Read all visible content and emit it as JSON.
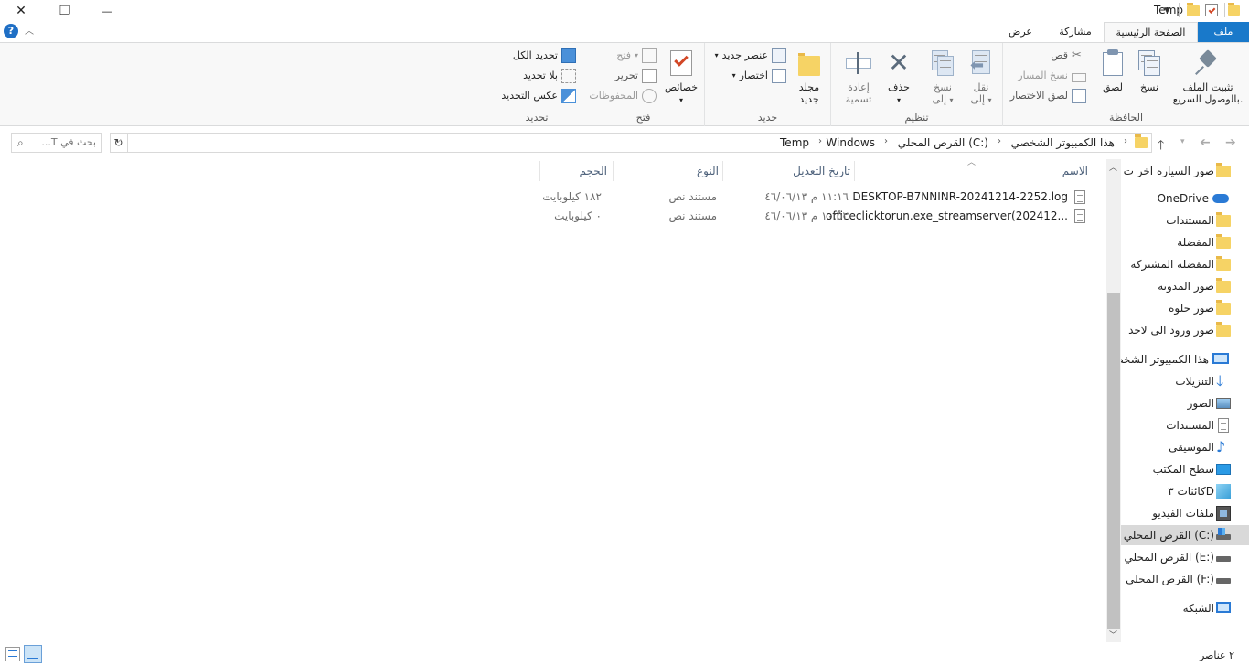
{
  "window": {
    "title": "Temp",
    "close_glyph": "✕",
    "restore_glyph": "❐",
    "minimize_glyph": "—"
  },
  "ribbon_tabs": [
    {
      "label": "ملف"
    },
    {
      "label": "الصفحة الرئيسية"
    },
    {
      "label": "مشاركة"
    },
    {
      "label": "عرض"
    }
  ],
  "help_glyph": "?",
  "clipboard": {
    "group_label": "الحافظة",
    "pin": "تثبيت الملف بالوصول السريع.",
    "copy": "نسخ",
    "paste": "لصق",
    "cut": "قص",
    "copy_path": "نسخ المسار",
    "paste_shortcut": "لصق الاختصار"
  },
  "organize": {
    "group_label": "تنظيم",
    "move_to": "نقل إلى",
    "copy_to": "نسخ إلى",
    "delete": "حذف",
    "rename": "إعادة تسمية"
  },
  "new": {
    "group_label": "جديد",
    "new_folder": "مجلد جديد",
    "new_item": "عنصر جديد",
    "shortcut": "اختصار"
  },
  "open": {
    "group_label": "فتح",
    "properties": "خصائص",
    "open": "فتح",
    "edit": "تحرير",
    "history": "المحفوظات"
  },
  "select": {
    "group_label": "تحديد",
    "select_all": "تحديد الكل",
    "select_none": "بلا تحديد",
    "invert": "عكس التحديد"
  },
  "address": {
    "crumbs": [
      "هذا الكمبيوتر الشخصي",
      "القرص المحلي (C:)",
      "Windows",
      "Temp"
    ],
    "search_placeholder": "بحث في T..."
  },
  "columns": {
    "name": "الاسم",
    "modified": "تاريخ التعديل",
    "type": "النوع",
    "size": "الحجم"
  },
  "files": [
    {
      "name": "DESKTOP-B7NNINR-20241214-2252.log",
      "modified": "١١:١٦ م ٤٦/٠٦/١٣",
      "type": "مستند نص",
      "size": "١٨٢ كيلوبايت"
    },
    {
      "name": "officeclicktorun.exe_streamserver(202412...",
      "modified": "١٠:٥٢ م ٤٦/٠٦/١٣",
      "type": "مستند نص",
      "size": "٠ كيلوبايت"
    }
  ],
  "nav_pane": [
    {
      "label": "صور السياره اخر ت",
      "icon": "folder-icon"
    },
    {
      "label": "OneDrive",
      "icon": "cloud-icon"
    },
    {
      "label": "المستندات",
      "icon": "folder-icon"
    },
    {
      "label": "المفضلة",
      "icon": "folder-icon"
    },
    {
      "label": "المفضلة المشتركة",
      "icon": "folder-icon"
    },
    {
      "label": "صور المدونة",
      "icon": "folder-icon"
    },
    {
      "label": "صور حلوه",
      "icon": "folder-icon"
    },
    {
      "label": "صور ورود الى لاحد",
      "icon": "folder-icon"
    },
    {
      "label": "هذا الكمبيوتر الشخصي",
      "icon": "computer-icon"
    },
    {
      "label": "التنزيلات",
      "icon": "download-icon"
    },
    {
      "label": "الصور",
      "icon": "pictures-icon"
    },
    {
      "label": "المستندات",
      "icon": "documents-icon"
    },
    {
      "label": "الموسيقى",
      "icon": "music-icon"
    },
    {
      "label": "سطح المكتب",
      "icon": "desktop-icon"
    },
    {
      "label": "كائنات ٣D",
      "icon": "3d-objects-icon"
    },
    {
      "label": "ملفات الفيديو",
      "icon": "video-icon"
    },
    {
      "label": "القرص المحلي (C:)",
      "icon": "drive-icon"
    },
    {
      "label": "القرص المحلي (E:)",
      "icon": "drive-icon"
    },
    {
      "label": "القرص المحلي (F:)",
      "icon": "drive-icon"
    },
    {
      "label": "الشبكة",
      "icon": "network-icon"
    }
  ],
  "status": {
    "count": "٢ عناصر"
  },
  "colors": {
    "file_tab": "#1979ca",
    "selection": "#d9d9d9",
    "header_text": "#4c607a"
  }
}
